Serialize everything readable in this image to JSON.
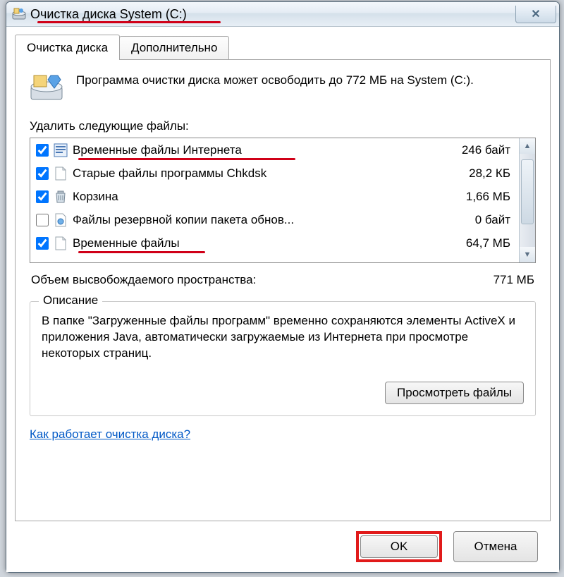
{
  "window": {
    "title": "Очистка диска System (C:)"
  },
  "tabs": {
    "cleanup": "Очистка диска",
    "advanced": "Дополнительно"
  },
  "intro": "Программа очистки диска может освободить до 772 МБ на System (C:).",
  "list_label": "Удалить следующие файлы:",
  "files": [
    {
      "checked": true,
      "name": "Временные файлы Интернета",
      "size": "246 байт"
    },
    {
      "checked": true,
      "name": "Старые файлы программы Chkdsk",
      "size": "28,2 КБ"
    },
    {
      "checked": true,
      "name": "Корзина",
      "size": "1,66 МБ"
    },
    {
      "checked": false,
      "name": "Файлы резервной копии пакета обнов...",
      "size": "0 байт"
    },
    {
      "checked": true,
      "name": "Временные файлы",
      "size": "64,7 МБ"
    }
  ],
  "total": {
    "label": "Объем высвобождаемого пространства:",
    "value": "771 МБ"
  },
  "description": {
    "group_label": "Описание",
    "text": "В папке \"Загруженные файлы программ\" временно сохраняются элементы ActiveX и приложения Java, автоматически загружаемые из Интернета при просмотре некоторых страниц."
  },
  "buttons": {
    "view_files": "Просмотреть файлы",
    "ok": "OK",
    "cancel": "Отмена"
  },
  "help_link": "Как работает очистка диска?"
}
